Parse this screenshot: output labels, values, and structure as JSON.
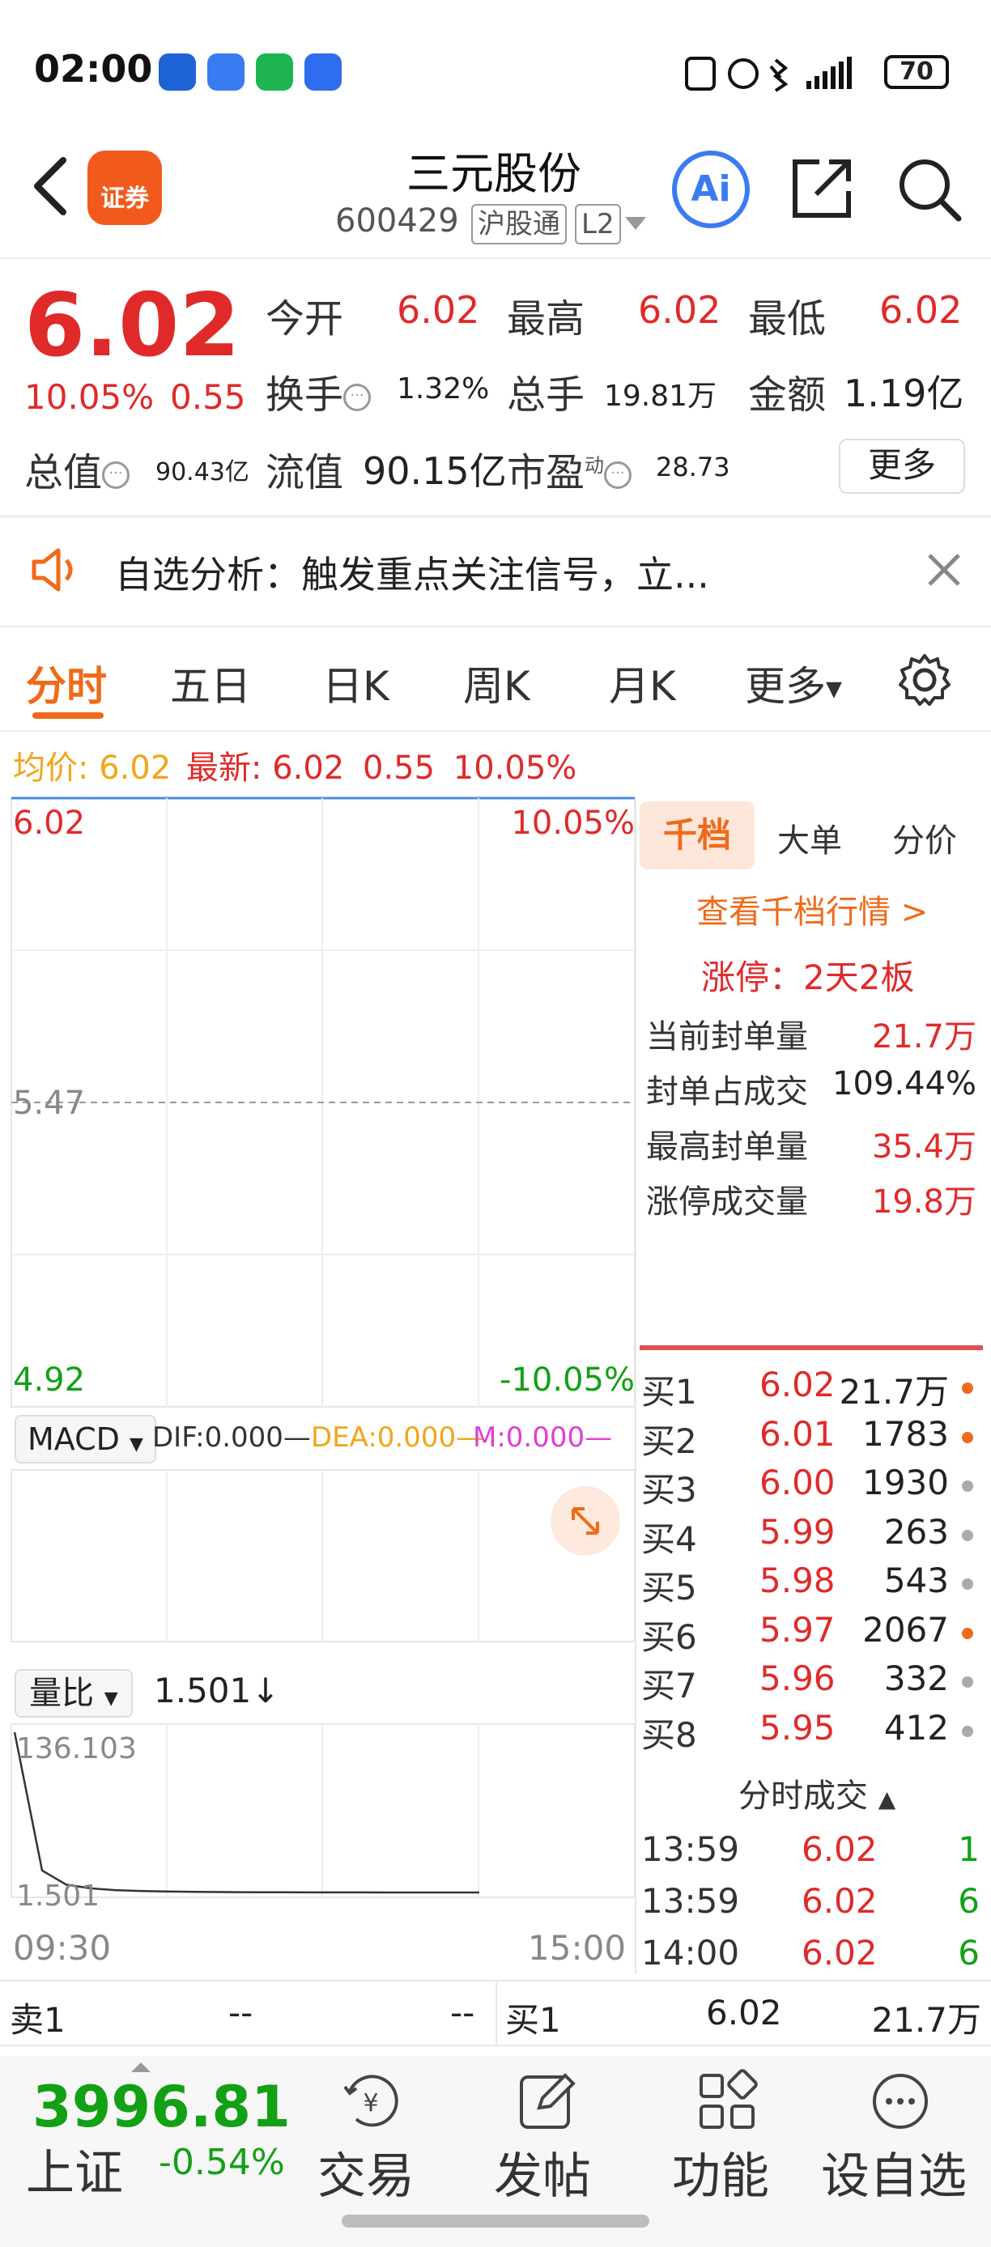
{
  "status_bar": {
    "time": "02:00",
    "battery": "70",
    "app_icon_colors": [
      "#1e63d6",
      "#3a7bf2",
      "#1fb452",
      "#2f6df0"
    ]
  },
  "header": {
    "broker_logo_text": "证券",
    "stock_name": "三元股份",
    "stock_code": "600429",
    "tag_connect": "沪股通",
    "tag_level": "L2",
    "ai_label": "Ai"
  },
  "quote": {
    "price": "6.02",
    "change_pct": "10.05%",
    "change_amt": "0.55",
    "items": [
      {
        "label": "今开",
        "value": "6.02"
      },
      {
        "label": "最高",
        "value": "6.02"
      },
      {
        "label": "最低",
        "value": "6.02"
      },
      {
        "label": "换手",
        "value": "1.32%"
      },
      {
        "label": "总手",
        "value": "19.81万"
      },
      {
        "label": "金额",
        "value": "1.19亿"
      },
      {
        "label": "总值",
        "value": "90.43亿"
      },
      {
        "label": "流值",
        "value": "90.15亿"
      },
      {
        "label": "市盈",
        "sup": "动",
        "value": "28.73"
      }
    ],
    "more_label": "更多"
  },
  "notice": {
    "text": "自选分析：触发重点关注信号，立..."
  },
  "tabs": [
    "分时",
    "五日",
    "日K",
    "周K",
    "月K",
    "更多"
  ],
  "avg_row": {
    "avg_label": "均价:",
    "avg_value": "6.02",
    "latest_label": "最新:",
    "latest_value": "6.02",
    "latest_change": "0.55",
    "latest_pct": "10.05%"
  },
  "chart": {
    "price_top": "6.02",
    "price_mid": "5.47",
    "price_bottom": "4.92",
    "pct_top": "10.05%",
    "pct_bottom": "-10.05%",
    "macd_label": "MACD",
    "macd_dif": "DIF:0.000—",
    "macd_dea": "DEA:0.000—",
    "macd_m": "M:0.000—",
    "volratio_label": "量比",
    "volratio_value": "1.501↓",
    "volratio_top": "136.103",
    "volratio_bottom": "1.501",
    "time_start": "09:30",
    "time_end": "15:00"
  },
  "chart_data": {
    "type": "line",
    "title": "",
    "series": [
      {
        "values": [
          136.103,
          20,
          8,
          5,
          3.5,
          2.8,
          2.4,
          2.1,
          1.9,
          1.8,
          1.7,
          1.65,
          1.6,
          1.57,
          1.55,
          1.53,
          1.52,
          1.51,
          1.505,
          1.501
        ]
      }
    ],
    "ylim": [
      1.501,
      136.103
    ],
    "xlabel": "",
    "ylabel": "",
    "x_start": "09:30",
    "x_end": "15:00"
  },
  "side_tabs": [
    "千档",
    "大单",
    "分价"
  ],
  "side": {
    "view_link": "查看千档行情 >",
    "limit_up": "涨停：2天2板",
    "stats": [
      {
        "label": "当前封单量",
        "value": "21.7万"
      },
      {
        "label": "封单占成交",
        "value": "109.44%"
      },
      {
        "label": "最高封单量",
        "value": "35.4万"
      },
      {
        "label": "涨停成交量",
        "value": "19.8万"
      }
    ],
    "bids": [
      {
        "label": "买1",
        "price": "6.02",
        "vol": "21.7万",
        "dot": "#f06a1a"
      },
      {
        "label": "买2",
        "price": "6.01",
        "vol": "1783",
        "dot": "#f06a1a"
      },
      {
        "label": "买3",
        "price": "6.00",
        "vol": "1930",
        "dot": "#aaaaaa"
      },
      {
        "label": "买4",
        "price": "5.99",
        "vol": "263",
        "dot": "#aaaaaa"
      },
      {
        "label": "买5",
        "price": "5.98",
        "vol": "543",
        "dot": "#aaaaaa"
      },
      {
        "label": "买6",
        "price": "5.97",
        "vol": "2067",
        "dot": "#f06a1a"
      },
      {
        "label": "买7",
        "price": "5.96",
        "vol": "332",
        "dot": "#aaaaaa"
      },
      {
        "label": "买8",
        "price": "5.95",
        "vol": "412",
        "dot": "#aaaaaa"
      }
    ],
    "ticks_title": "分时成交",
    "ticks": [
      {
        "time": "13:59",
        "price": "6.02",
        "vol": "1"
      },
      {
        "time": "13:59",
        "price": "6.02",
        "vol": "6"
      },
      {
        "time": "14:00",
        "price": "6.02",
        "vol": "6"
      }
    ]
  },
  "bottom_quote": {
    "sell_label": "卖1",
    "sell_price": "--",
    "sell_vol": "--",
    "buy_label": "买1",
    "buy_price": "6.02",
    "buy_vol": "21.7万"
  },
  "bottom_nav": {
    "index_value": "3996.81",
    "index_name": "上证",
    "index_change": "-0.54%",
    "items": [
      "交易",
      "发帖",
      "功能",
      "设自选"
    ]
  }
}
